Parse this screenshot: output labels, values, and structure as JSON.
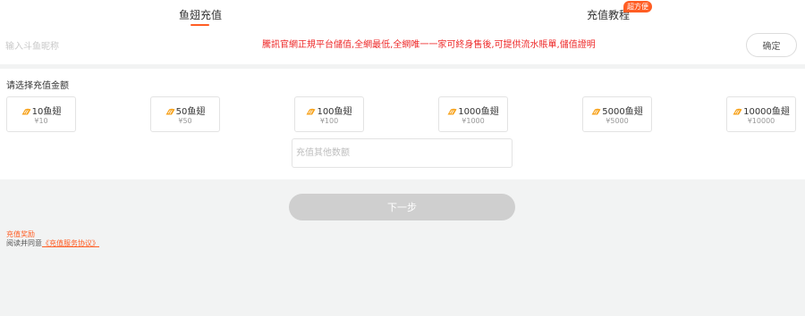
{
  "tabs": {
    "recharge": "鱼翅充值",
    "tutorial": "充值教程",
    "tutorial_badge": "超方便"
  },
  "nickname": {
    "placeholder": "输入斗鱼昵称",
    "value": ""
  },
  "notice": "騰訊官網正規平台儲值,全網最低,全網唯一一家可終身售後,可提供流水賬單,儲值證明",
  "confirm_label": "确定",
  "amount": {
    "label": "请选择充值金额",
    "options": [
      {
        "title": "10鱼翅",
        "price": "¥10"
      },
      {
        "title": "50鱼翅",
        "price": "¥50"
      },
      {
        "title": "100鱼翅",
        "price": "¥100"
      },
      {
        "title": "1000鱼翅",
        "price": "¥1000"
      },
      {
        "title": "5000鱼翅",
        "price": "¥5000"
      },
      {
        "title": "10000鱼翅",
        "price": "¥10000"
      }
    ],
    "other_placeholder": "充值其他数额"
  },
  "next_label": "下一步",
  "reward_label": "充值奖励",
  "agreement": {
    "prefix": "阅读并同意",
    "link": "《充值服务协议》"
  },
  "icons": {
    "fin": "fin-coin-icon"
  },
  "colors": {
    "accent": "#ff5d23",
    "notice": "#ee2929",
    "disabled_button": "#cfcfcf"
  }
}
